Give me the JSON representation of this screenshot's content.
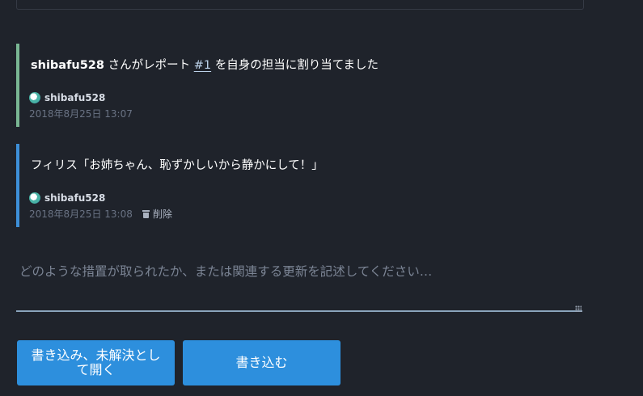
{
  "assign_event": {
    "user": "shibafu528",
    "text_before": " さんがレポート ",
    "report_link": "#1",
    "text_after": " を自身の担当に割り当てました",
    "author": "shibafu528",
    "timestamp": "2018年8月25日 13:07"
  },
  "comment_event": {
    "text": "フィリス「お姉ちゃん、恥ずかしいから静かにして！」",
    "author": "shibafu528",
    "timestamp": "2018年8月25日 13:08",
    "delete_label": "削除"
  },
  "reply": {
    "placeholder": "どのような措置が取られたか、または関連する更新を記述してください…",
    "value": ""
  },
  "actions": {
    "submit_close_label": "書き込み、未解決として開く",
    "submit_label": "書き込む"
  },
  "colors": {
    "background": "#1f232b",
    "assign_bar": "#79b693",
    "comment_bar": "#3d8fd8",
    "button": "#2d8fdd"
  }
}
